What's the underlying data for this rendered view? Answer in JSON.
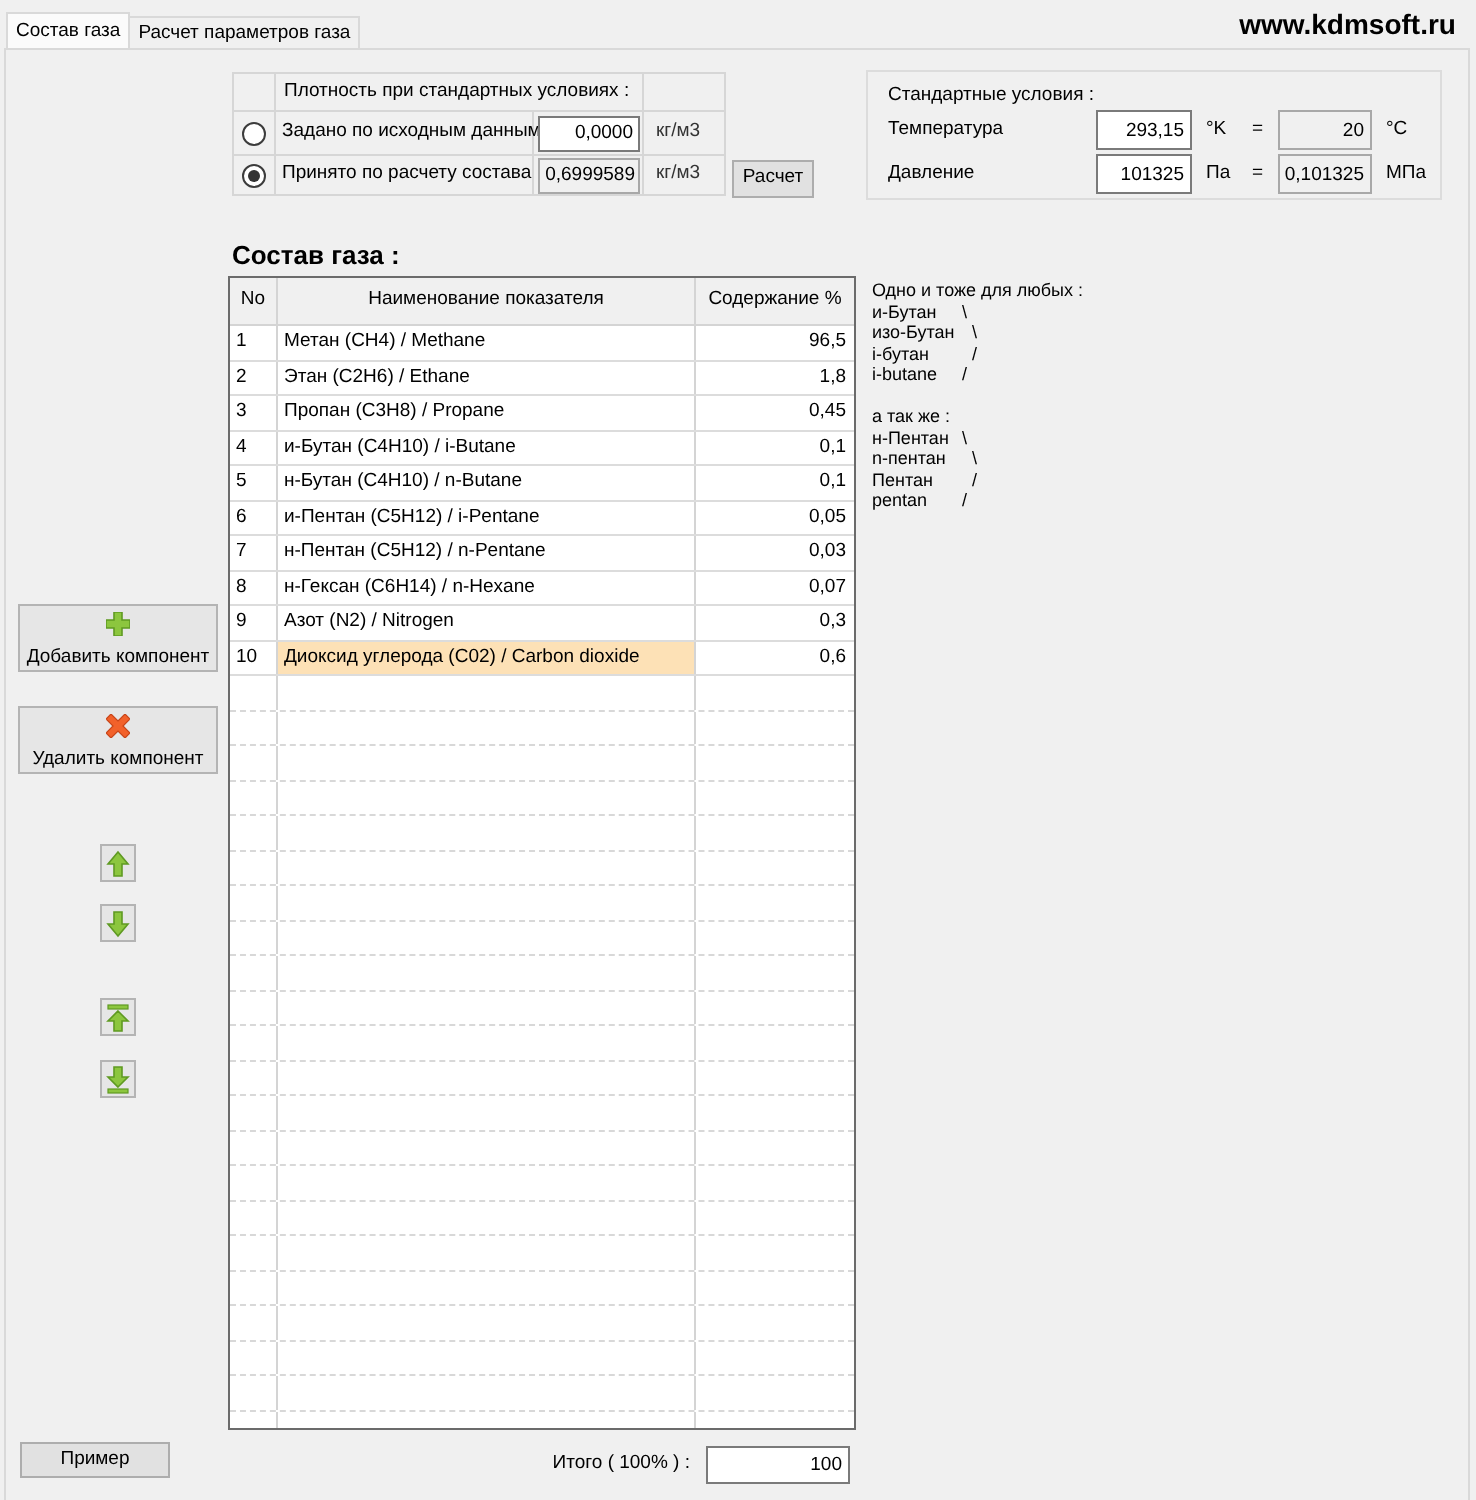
{
  "tabs": [
    {
      "label": "Состав газа",
      "selected": true
    },
    {
      "label": "Расчет параметров газа",
      "selected": false
    }
  ],
  "site_label": "www.kdmsoft.ru",
  "density": {
    "title": "Плотность при стандартных условиях :",
    "options": [
      {
        "label": "Задано по исходным данным",
        "selected": false,
        "value": "0,0000",
        "unit": "кг/м3",
        "readonly": false
      },
      {
        "label": "Принято по расчету состава",
        "selected": true,
        "value": "0,6999589",
        "unit": "кг/м3",
        "readonly": true
      }
    ],
    "calc_button": "Расчет"
  },
  "standard_conditions": {
    "title": "Стандартные условия :",
    "rows": [
      {
        "label": "Температура",
        "value": "293,15",
        "unit": "°K",
        "equals": "=",
        "converted": "20",
        "converted_unit": "°C"
      },
      {
        "label": "Давление",
        "value": "101325",
        "unit": "Па",
        "equals": "=",
        "converted": "0,101325",
        "converted_unit": "МПа"
      }
    ]
  },
  "side_buttons": {
    "add": "Добавить компонент",
    "delete": "Удалить компонент"
  },
  "composition": {
    "title": "Состав газа :",
    "columns": [
      "No",
      "Наименование показателя",
      "Содержание %"
    ],
    "rows": [
      {
        "no": "1",
        "name": "Метан (CH4) / Methane",
        "content": "96,5",
        "selected": false
      },
      {
        "no": "2",
        "name": "Этан (C2H6) / Ethane",
        "content": "1,8",
        "selected": false
      },
      {
        "no": "3",
        "name": "Пропан (C3H8) / Propane",
        "content": "0,45",
        "selected": false
      },
      {
        "no": "4",
        "name": "и-Бутан (C4H10) / i-Butane",
        "content": "0,1",
        "selected": false
      },
      {
        "no": "5",
        "name": "н-Бутан (C4H10) / n-Butane",
        "content": "0,1",
        "selected": false
      },
      {
        "no": "6",
        "name": "и-Пентан (C5H12) / i-Pentane",
        "content": "0,05",
        "selected": false
      },
      {
        "no": "7",
        "name": "н-Пентан (C5H12) / n-Pentane",
        "content": "0,03",
        "selected": false
      },
      {
        "no": "8",
        "name": "н-Гексан (C6H14) / n-Hexane",
        "content": "0,07",
        "selected": false
      },
      {
        "no": "9",
        "name": "Азот (N2) / Nitrogen",
        "content": "0,3",
        "selected": false
      },
      {
        "no": "10",
        "name": "Диоксид углерода (C02) / Carbon dioxide",
        "content": "0,6",
        "selected": true
      }
    ]
  },
  "notes": [
    {
      "heading": "Одно и тоже для любых :",
      "items": [
        {
          "text": "и-Бутан",
          "brace": "\\"
        },
        {
          "text": "изо-Бутан",
          "brace": "\\"
        },
        {
          "text": "i-бутан",
          "brace": "/"
        },
        {
          "text": "i-butane",
          "brace": "/"
        }
      ]
    },
    {
      "heading": "а так же :",
      "items": [
        {
          "text": "н-Пентан",
          "brace": "\\"
        },
        {
          "text": "n-пентан",
          "brace": "\\"
        },
        {
          "text": "Пентан",
          "brace": "/"
        },
        {
          "text": "pentan",
          "brace": "/"
        }
      ]
    }
  ],
  "example_button": "Пример",
  "total": {
    "label": "Итого ( 100% ) :",
    "value": "100"
  }
}
